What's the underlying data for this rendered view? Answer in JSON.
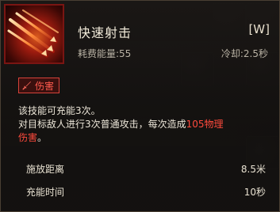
{
  "skill": {
    "name": "快速射击",
    "hotkey": "[W]",
    "cost": "耗费能量:55",
    "cooldown": "冷却:2.5秒",
    "icon": "arrow-volley-icon"
  },
  "tag": {
    "label": "伤害",
    "icon": "sword-icon",
    "color": "#ff5a4e"
  },
  "description": {
    "line1": "该技能可充能3次。",
    "line2_prefix": "对目标敌人进行3次普通攻击，每次造成",
    "damage_text": "105物理",
    "line3_damage": "伤害",
    "line3_suffix": "。",
    "damage_color": "#ff4a3c"
  },
  "stats": [
    {
      "label": "施放距离",
      "value": "8.5米"
    },
    {
      "label": "充能时间",
      "value": "10秒"
    }
  ]
}
